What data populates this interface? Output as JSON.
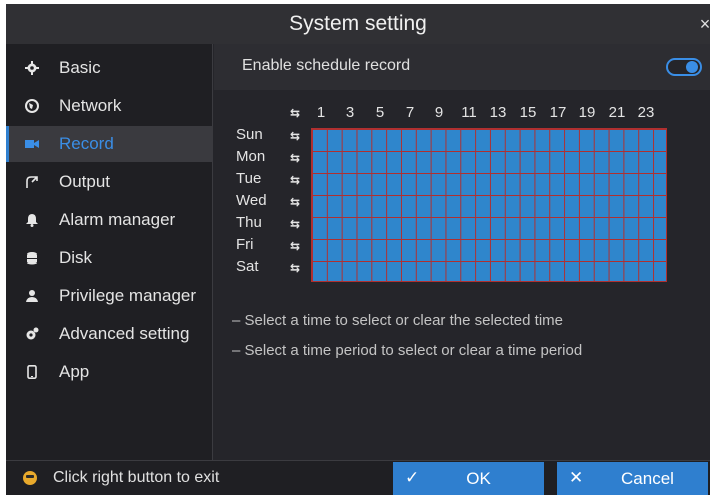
{
  "window": {
    "title": "System setting",
    "close_glyph": "×"
  },
  "sidebar": {
    "items": [
      {
        "label": "Basic",
        "icon": "gear-icon",
        "active": false
      },
      {
        "label": "Network",
        "icon": "globe-icon",
        "active": false
      },
      {
        "label": "Record",
        "icon": "camera-icon",
        "active": true
      },
      {
        "label": "Output",
        "icon": "output-icon",
        "active": false
      },
      {
        "label": "Alarm manager",
        "icon": "bell-icon",
        "active": false
      },
      {
        "label": "Disk",
        "icon": "database-icon",
        "active": false
      },
      {
        "label": "Privilege manager",
        "icon": "user-icon",
        "active": false
      },
      {
        "label": "Advanced setting",
        "icon": "cog-icon",
        "active": false
      },
      {
        "label": "App",
        "icon": "phone-icon",
        "active": false
      }
    ]
  },
  "schedule": {
    "enable_label": "Enable schedule record",
    "enabled": true,
    "hour_labels": [
      "1",
      "3",
      "5",
      "7",
      "9",
      "11",
      "13",
      "15",
      "17",
      "19",
      "21",
      "23"
    ],
    "days": [
      "Sun",
      "Mon",
      "Tue",
      "Wed",
      "Thu",
      "Fri",
      "Sat"
    ],
    "select_glyph": "⇆",
    "colors": {
      "selected": "#2f86cc",
      "grid_line": "#b03030",
      "accent": "#2f7fcf"
    }
  },
  "hints": [
    "– Select a time to select or clear the selected time",
    "– Select a time period to select or clear a time period"
  ],
  "footer": {
    "exit_text": "Click right button to exit",
    "ok_label": "OK",
    "cancel_label": "Cancel",
    "ok_glyph": "✓",
    "cancel_glyph": "✕"
  }
}
